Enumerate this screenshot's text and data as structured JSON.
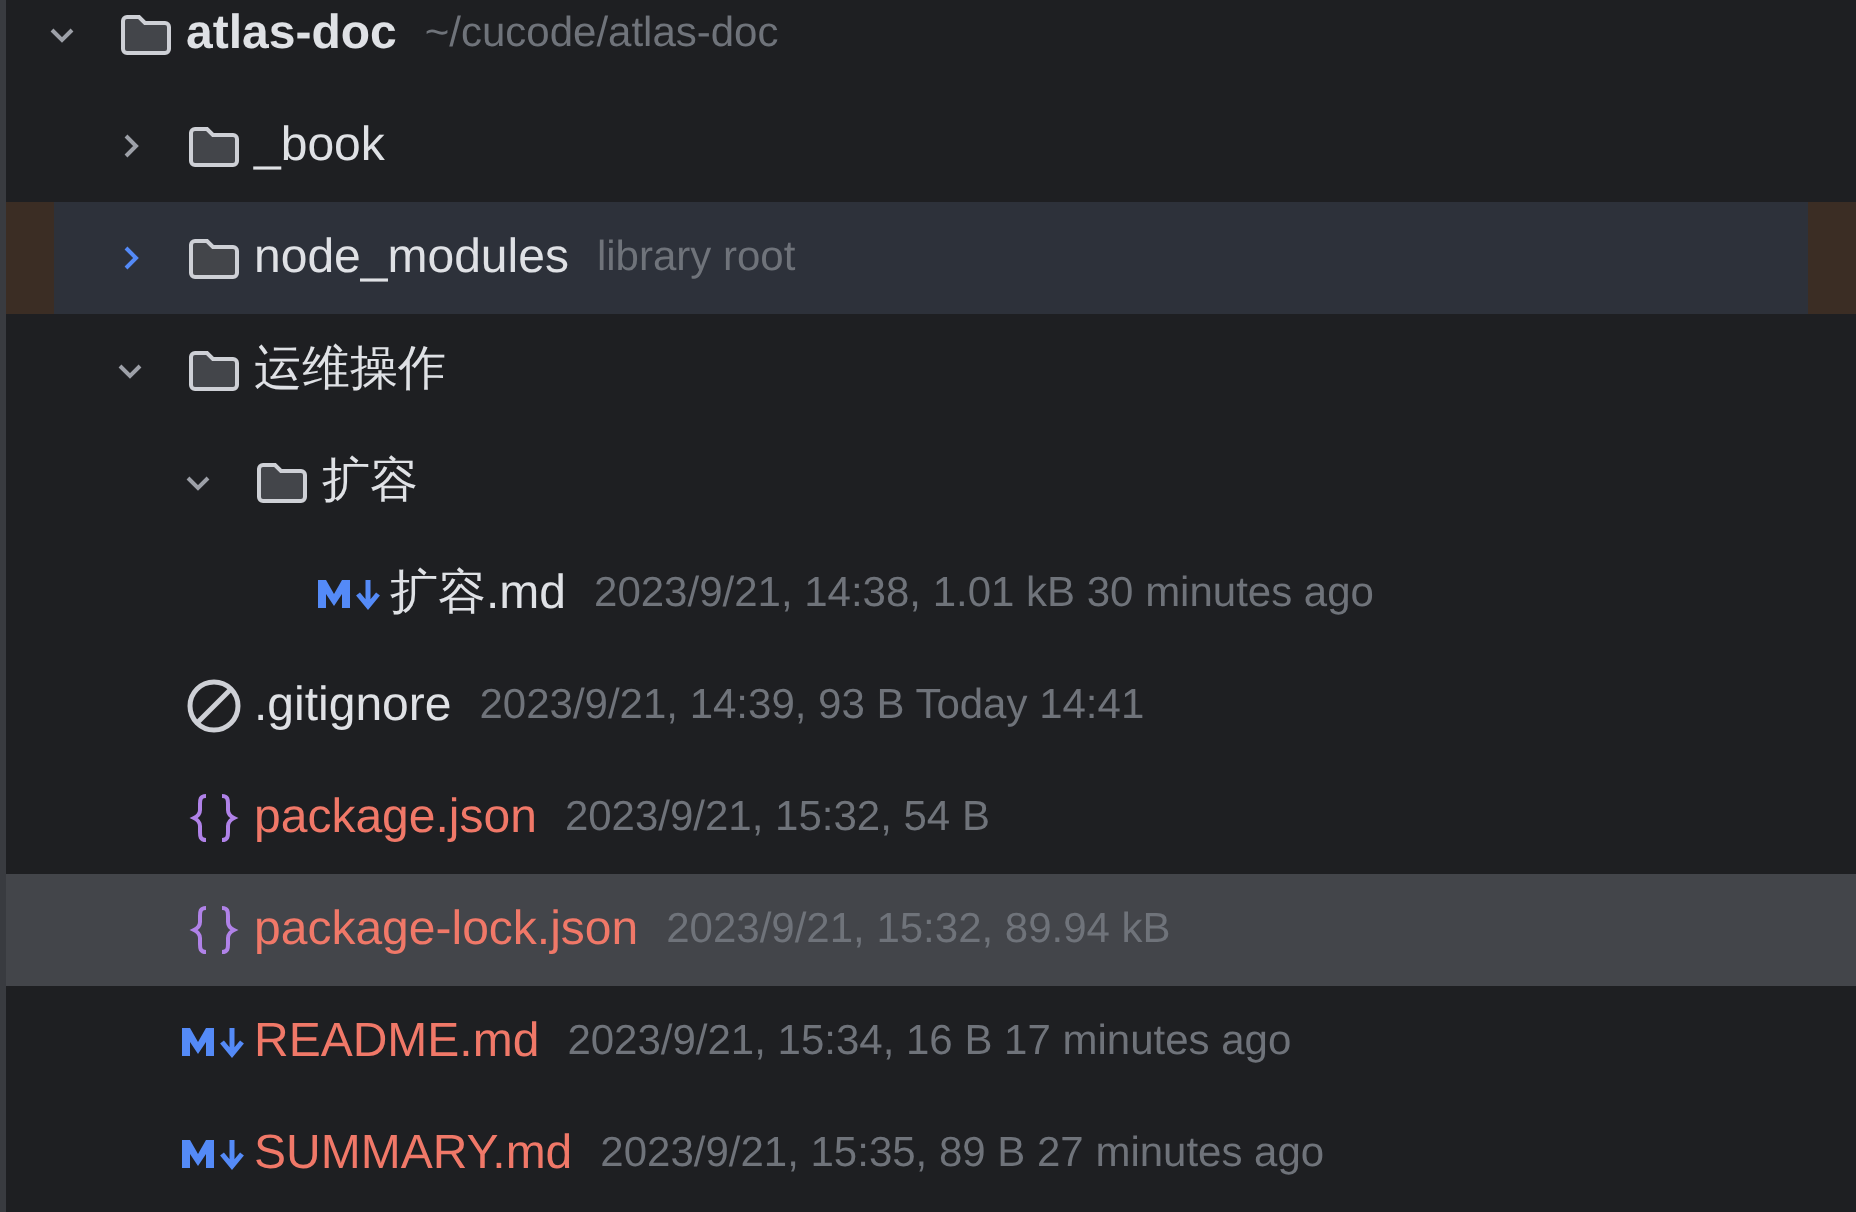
{
  "tree": {
    "kind": "folder",
    "name": "atlas-doc",
    "detail": "~/cucode/atlas-doc",
    "expanded": true,
    "selected": false,
    "highlighted": false,
    "untracked": false,
    "children": [
      {
        "kind": "folder",
        "name": "_book",
        "expanded": false,
        "selected": false,
        "highlighted": false,
        "untracked": false
      },
      {
        "kind": "folder",
        "name": "node_modules",
        "detail": "library root",
        "expanded": false,
        "selected": false,
        "highlighted": true,
        "untracked": false
      },
      {
        "kind": "folder",
        "name": "运维操作",
        "expanded": true,
        "selected": false,
        "highlighted": false,
        "untracked": false,
        "children": [
          {
            "kind": "folder",
            "name": "扩容",
            "expanded": true,
            "selected": false,
            "highlighted": false,
            "untracked": false,
            "children": [
              {
                "kind": "markdown",
                "name": "扩容.md",
                "detail": "2023/9/21, 14:38, 1.01 kB 30 minutes ago",
                "selected": false,
                "highlighted": false,
                "untracked": false
              }
            ]
          }
        ]
      },
      {
        "kind": "ignore",
        "name": ".gitignore",
        "detail": "2023/9/21, 14:39, 93 B Today 14:41",
        "selected": false,
        "highlighted": false,
        "untracked": false
      },
      {
        "kind": "json",
        "name": "package.json",
        "detail": "2023/9/21, 15:32, 54 B",
        "selected": false,
        "highlighted": false,
        "untracked": true
      },
      {
        "kind": "json",
        "name": "package-lock.json",
        "detail": "2023/9/21, 15:32, 89.94 kB",
        "selected": true,
        "highlighted": false,
        "untracked": true
      },
      {
        "kind": "markdown",
        "name": "README.md",
        "detail": "2023/9/21, 15:34, 16 B 17 minutes ago",
        "selected": false,
        "highlighted": false,
        "untracked": true
      },
      {
        "kind": "markdown",
        "name": "SUMMARY.md",
        "detail": "2023/9/21, 15:35, 89 B 27 minutes ago",
        "selected": false,
        "highlighted": false,
        "untracked": true
      }
    ]
  }
}
